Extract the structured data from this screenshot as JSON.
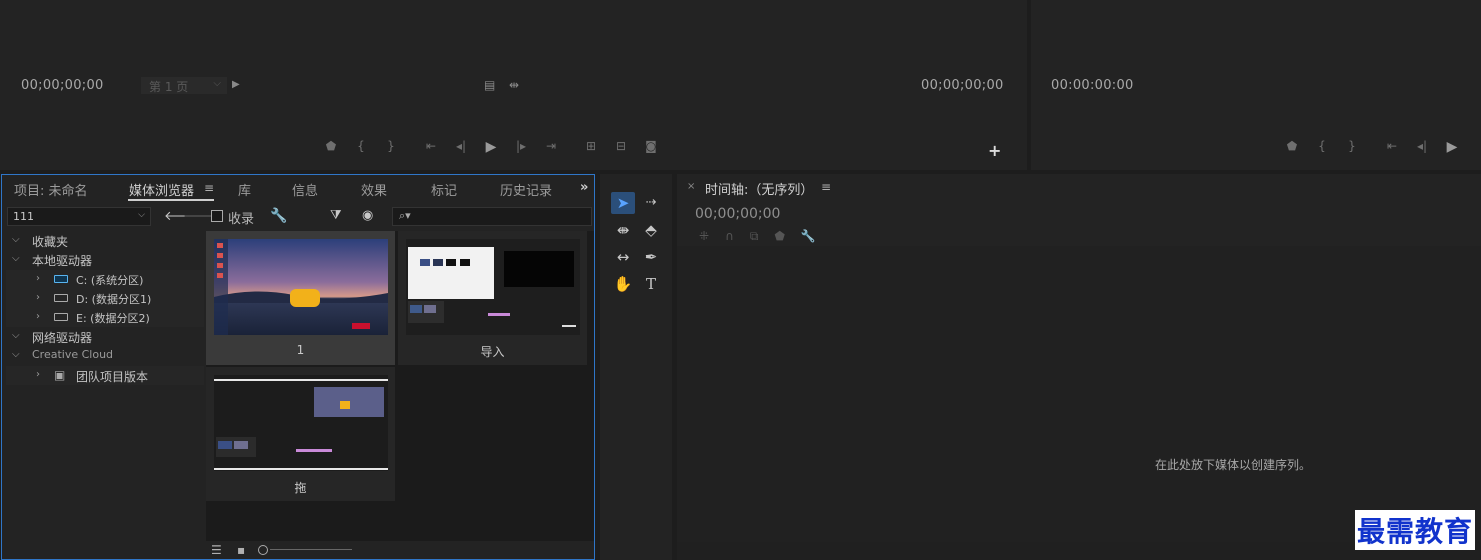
{
  "source_monitor": {
    "timecode_in": "00;00;00;00",
    "page_label": "第 1 页",
    "timecode_out": "00;00;00;00"
  },
  "program_monitor": {
    "timecode": "00:00:00:00"
  },
  "browser_panel": {
    "tabs": [
      "项目: 未命名",
      "媒体浏览器",
      "库",
      "信息",
      "效果",
      "标记",
      "历史记录"
    ],
    "more_glyph": "»",
    "path_value": "111",
    "ingest_label": "收录",
    "search_glyph": "⌕▾",
    "tree": {
      "favorites": "收藏夹",
      "local_drives": "本地驱动器",
      "drive_c": "C: (系统分区)",
      "drive_d": "D: (数据分区1)",
      "drive_e": "E: (数据分区2)",
      "network_drives": "网络驱动器",
      "creative_cloud": "Creative Cloud",
      "team_projects": "团队项目版本"
    },
    "thumbnails": [
      {
        "caption": "1"
      },
      {
        "caption": "导入"
      },
      {
        "caption": "拖"
      }
    ]
  },
  "timeline": {
    "title": "时间轴:（无序列）",
    "close_glyph": "×",
    "timecode": "00;00;00;00",
    "empty_message": "在此处放下媒体以创建序列。"
  },
  "watermark": "最需教育",
  "colors": {
    "accent_blue": "#2f76c8",
    "watermark_blue": "#1133cc"
  }
}
